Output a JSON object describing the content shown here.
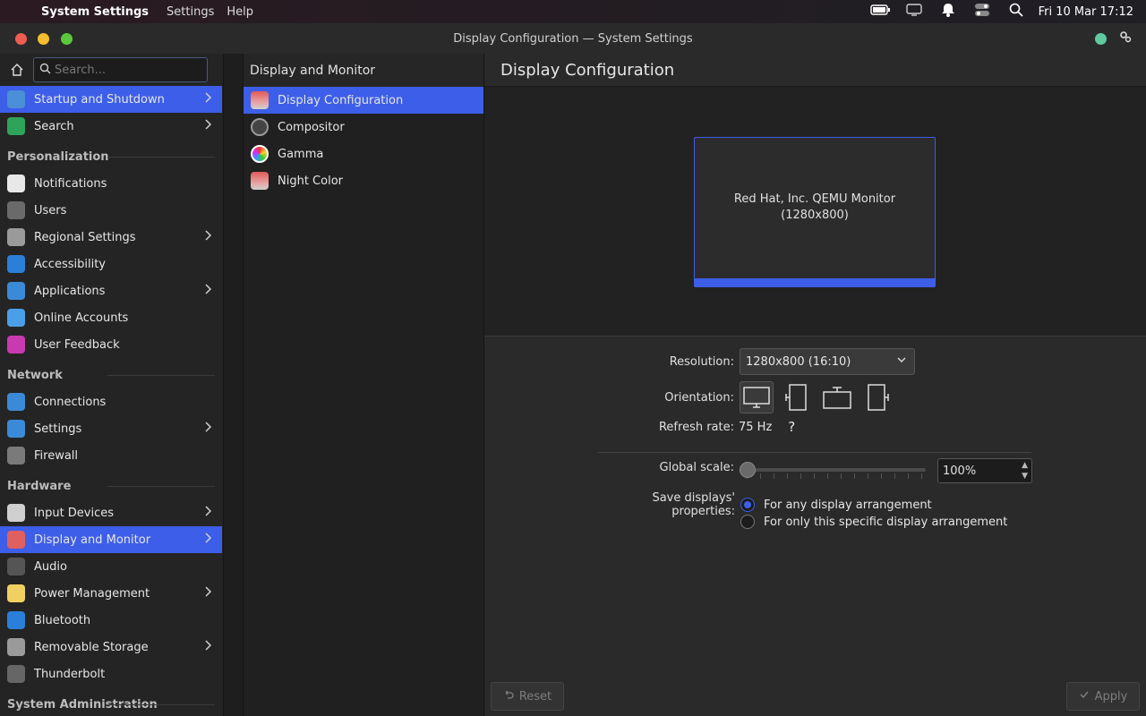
{
  "menubar": {
    "app_name": "System Settings",
    "menus": [
      "Settings",
      "Help"
    ],
    "clock": "Fri 10 Mar 17:12"
  },
  "window": {
    "title": "Display Configuration — System Settings"
  },
  "sidebar": {
    "search_placeholder": "Search...",
    "top_items": [
      {
        "label": "Startup and Shutdown",
        "icon": "startup-icon",
        "selected": true,
        "chevron": true
      },
      {
        "label": "Search",
        "icon": "search-settings-icon",
        "chevron": true
      }
    ],
    "sections": [
      {
        "header": "Personalization",
        "items": [
          {
            "label": "Notifications",
            "icon": "notifications-icon"
          },
          {
            "label": "Users",
            "icon": "users-icon"
          },
          {
            "label": "Regional Settings",
            "icon": "regional-icon",
            "chevron": true
          },
          {
            "label": "Accessibility",
            "icon": "accessibility-icon"
          },
          {
            "label": "Applications",
            "icon": "applications-icon",
            "chevron": true
          },
          {
            "label": "Online Accounts",
            "icon": "online-accounts-icon"
          },
          {
            "label": "User Feedback",
            "icon": "user-feedback-icon"
          }
        ]
      },
      {
        "header": "Network",
        "items": [
          {
            "label": "Connections",
            "icon": "connections-icon"
          },
          {
            "label": "Settings",
            "icon": "network-settings-icon",
            "chevron": true
          },
          {
            "label": "Firewall",
            "icon": "firewall-icon"
          }
        ]
      },
      {
        "header": "Hardware",
        "items": [
          {
            "label": "Input Devices",
            "icon": "input-devices-icon",
            "chevron": true
          },
          {
            "label": "Display and Monitor",
            "icon": "display-icon",
            "selected": true,
            "chevron": true
          },
          {
            "label": "Audio",
            "icon": "audio-icon"
          },
          {
            "label": "Power Management",
            "icon": "power-icon",
            "chevron": true
          },
          {
            "label": "Bluetooth",
            "icon": "bluetooth-icon"
          },
          {
            "label": "Removable Storage",
            "icon": "storage-icon",
            "chevron": true
          },
          {
            "label": "Thunderbolt",
            "icon": "thunderbolt-icon"
          }
        ]
      },
      {
        "header": "System Administration",
        "items": []
      }
    ]
  },
  "middle": {
    "title": "Display and Monitor",
    "items": [
      {
        "label": "Display Configuration",
        "selected": true
      },
      {
        "label": "Compositor"
      },
      {
        "label": "Gamma"
      },
      {
        "label": "Night Color"
      }
    ]
  },
  "content": {
    "title": "Display Configuration",
    "monitor": {
      "name": "Red Hat, Inc. QEMU Monitor",
      "resolution": "(1280x800)"
    },
    "resolution_label": "Resolution:",
    "resolution_value": "1280x800 (16:10)",
    "orientation_label": "Orientation:",
    "refresh_label": "Refresh rate:",
    "refresh_value": "75 Hz",
    "refresh_help": "?",
    "scale_label": "Global scale:",
    "scale_value": "100%",
    "save_label": "Save displays' properties:",
    "save_options": [
      "For any display arrangement",
      "For only this specific display arrangement"
    ],
    "reset_label": "Reset",
    "apply_label": "Apply"
  },
  "colors": {
    "accent": "#3d5ee8"
  }
}
